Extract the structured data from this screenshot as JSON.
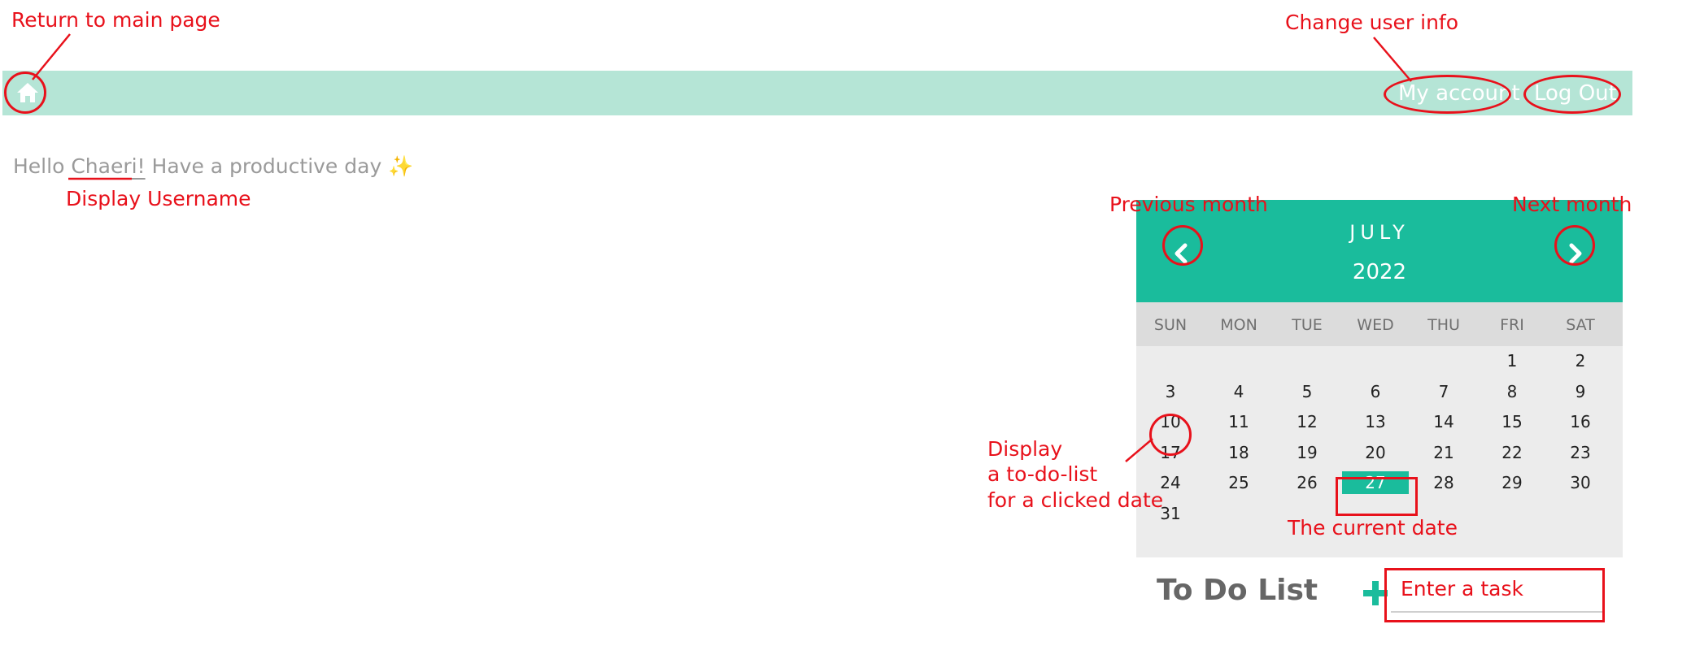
{
  "annotations": {
    "return_main": "Return to main page",
    "change_user": "Change user info",
    "display_username": "Display Username",
    "previous_month": "Previous month",
    "next_month": "Next month",
    "display_todo": [
      "Display",
      "a to-do-list",
      "for a clicked date"
    ],
    "current_date": "The current date",
    "enter_task": "Enter a task"
  },
  "nav": {
    "home_icon": "home-icon",
    "my_account": "My account",
    "logout": "Log Out"
  },
  "greeting": {
    "prefix": "Hello ",
    "username": "Chaeri!",
    "suffix": " Have a productive day ",
    "emoji": "✨"
  },
  "calendar": {
    "month": "JULY",
    "year": "2022",
    "weekdays": [
      "SUN",
      "MON",
      "TUE",
      "WED",
      "THU",
      "FRI",
      "SAT"
    ],
    "weeks": [
      [
        "",
        "",
        "",
        "",
        "",
        "1",
        "2"
      ],
      [
        "3",
        "4",
        "5",
        "6",
        "7",
        "8",
        "9"
      ],
      [
        "10",
        "11",
        "12",
        "13",
        "14",
        "15",
        "16"
      ],
      [
        "17",
        "18",
        "19",
        "20",
        "21",
        "22",
        "23"
      ],
      [
        "24",
        "25",
        "26",
        "27",
        "28",
        "29",
        "30"
      ],
      [
        "31",
        "",
        "",
        "",
        "",
        "",
        ""
      ]
    ],
    "today": "27",
    "selected": "10"
  },
  "todo": {
    "title": "To Do List",
    "input_value": ""
  },
  "colors": {
    "accent": "#1abc9c",
    "navbar": "#b5e5d6",
    "annotation": "#e8111b"
  }
}
